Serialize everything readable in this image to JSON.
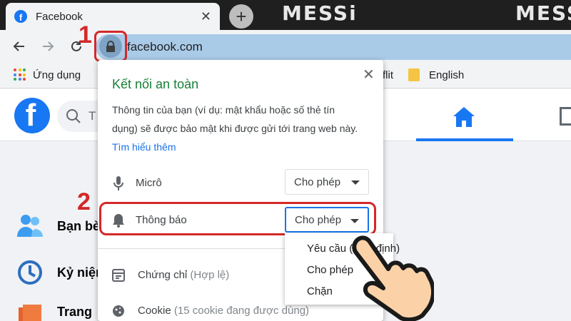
{
  "browser": {
    "tab": {
      "title": "Facebook",
      "close": "✕"
    },
    "new_tab": "+",
    "brand": "MESSi",
    "url": "facebook.com",
    "bookmarks": {
      "apps": "Ứng dụng",
      "partial": "flit",
      "english": "English"
    }
  },
  "site_info_popup": {
    "title": "Kết nối an toàn",
    "description": "Thông tin của bạn (ví dụ: mật khẩu hoặc số thẻ tín dụng) sẽ được bảo mật khi được gửi tới trang web này.",
    "learn_more": "Tìm hiểu thêm",
    "close": "✕",
    "permissions": [
      {
        "label": "Micrô",
        "value": "Cho phép"
      },
      {
        "label": "Thông báo",
        "value": "Cho phép"
      }
    ],
    "certificate": {
      "label": "Chứng chỉ",
      "status": "(Hợp lệ)"
    },
    "cookies": {
      "label": "Cookie",
      "status": "(15 cookie đang được dùng)"
    }
  },
  "dropdown_options": [
    "Yêu cầu (mặc định)",
    "Cho phép",
    "Chặn"
  ],
  "facebook": {
    "search_placeholder": "T",
    "sidebar": [
      "Bạn bè",
      "Kỷ niệm",
      "Trang"
    ]
  },
  "annotations": {
    "step1": "1",
    "step2": "2"
  },
  "colors": {
    "facebook_blue": "#1877f2",
    "annotation_red": "#d42828",
    "secure_green": "#188038",
    "omnibox_highlight": "#aacbe8"
  }
}
